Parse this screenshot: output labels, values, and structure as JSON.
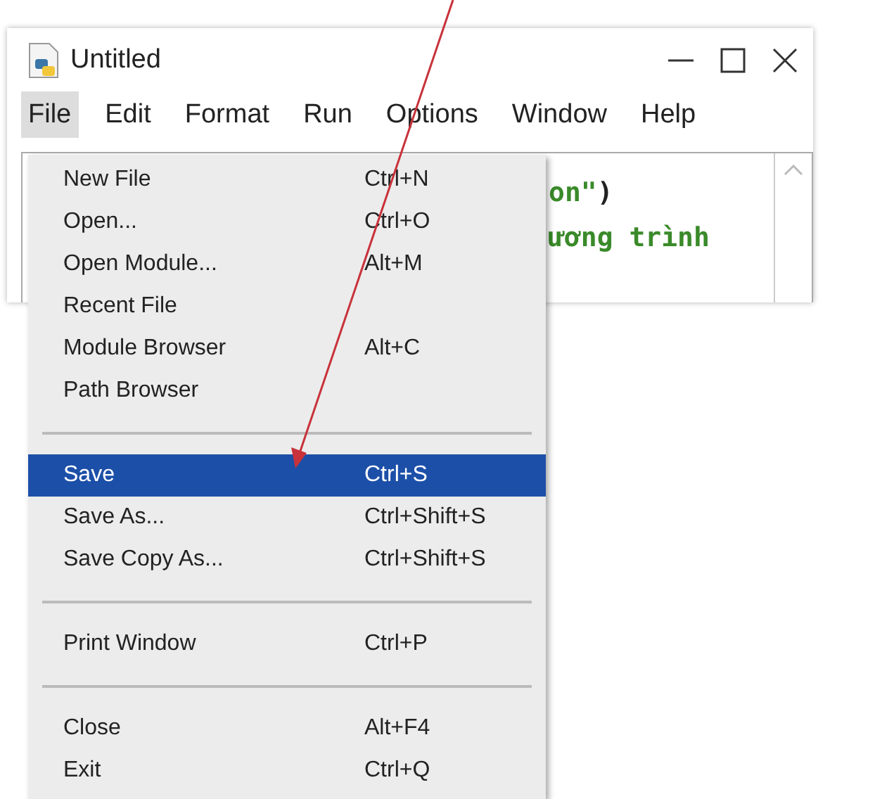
{
  "window": {
    "title": "Untitled"
  },
  "menubar": [
    {
      "label": "File",
      "selected": true
    },
    {
      "label": "Edit",
      "selected": false
    },
    {
      "label": "Format",
      "selected": false
    },
    {
      "label": "Run",
      "selected": false
    },
    {
      "label": "Options",
      "selected": false
    },
    {
      "label": "Window",
      "selected": false
    },
    {
      "label": "Help",
      "selected": false
    }
  ],
  "editor": {
    "lines": [
      [
        {
          "text": "on\"",
          "kind": "string"
        },
        {
          "text": ")",
          "kind": "plain"
        }
      ],
      [
        {
          "text": "ương trình",
          "kind": "string"
        }
      ]
    ]
  },
  "file_menu": {
    "sections": [
      [
        {
          "label": "New File",
          "shortcut": "Ctrl+N",
          "selected": false
        },
        {
          "label": "Open...",
          "shortcut": "Ctrl+O",
          "selected": false
        },
        {
          "label": "Open Module...",
          "shortcut": "Alt+M",
          "selected": false
        },
        {
          "label": "Recent File",
          "selected": false
        },
        {
          "label": "Module Browser",
          "shortcut": "Alt+C",
          "selected": false
        },
        {
          "label": "Path Browser",
          "selected": false
        }
      ],
      [
        {
          "label": "Save",
          "shortcut": "Ctrl+S",
          "selected": true
        },
        {
          "label": "Save As...",
          "shortcut": "Ctrl+Shift+S",
          "selected": false
        },
        {
          "label": "Save Copy As...",
          "shortcut": "Ctrl+Shift+S",
          "selected": false
        }
      ],
      [
        {
          "label": "Print Window",
          "shortcut": "Ctrl+P",
          "selected": false
        }
      ],
      [
        {
          "label": "Close",
          "shortcut": "Alt+F4",
          "selected": false
        },
        {
          "label": "Exit",
          "shortcut": "Ctrl+Q",
          "selected": false
        }
      ]
    ]
  }
}
